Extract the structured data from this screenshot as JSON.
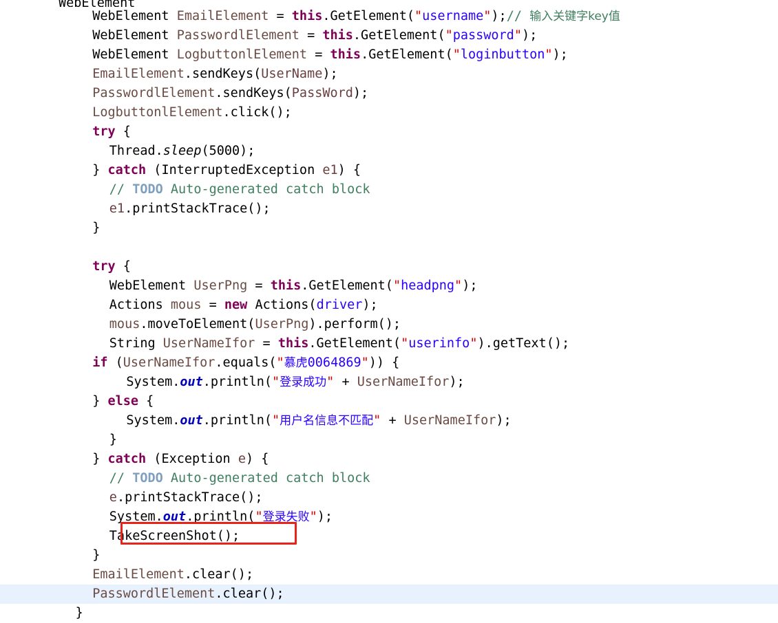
{
  "editor": {
    "name": "java-code-editor",
    "language": "Java",
    "background": "#ffffff",
    "current_line_highlight": "#e8f2fe",
    "annotation_color": "#e8231a",
    "colors": {
      "keyword": "#7f0055",
      "string": "#2a00ff",
      "quote": "#d40000",
      "comment": "#3f7f5f",
      "todo": "#7f9fbf",
      "field": "#6a4b43",
      "static_field": "#0000c0",
      "plain": "#000000"
    }
  },
  "annotation": {
    "label": "red-rectangle-around-takescreenshot-call",
    "target_text": "TakeScreenShot();"
  },
  "code": {
    "lines": [
      {
        "id": "line-partial-top",
        "indent": 0,
        "clipped": true,
        "tokens": [
          {
            "t": "WebElement ",
            "c": "plain"
          }
        ]
      },
      {
        "id": "line-1",
        "indent": 2,
        "tokens": [
          {
            "t": "WebElement ",
            "c": "plain"
          },
          {
            "t": "EmailElement",
            "c": "field"
          },
          {
            "t": " = ",
            "c": "plain"
          },
          {
            "t": "this",
            "c": "kw"
          },
          {
            "t": ".GetElement(",
            "c": "plain"
          },
          {
            "t": "\"",
            "c": "quote"
          },
          {
            "t": "username",
            "c": "str"
          },
          {
            "t": "\"",
            "c": "quote"
          },
          {
            "t": ");",
            "c": "plain"
          },
          {
            "t": "// ",
            "c": "cmt"
          },
          {
            "t": "输入关键字key值",
            "c": "cmt cjk"
          }
        ]
      },
      {
        "id": "line-2",
        "indent": 2,
        "tokens": [
          {
            "t": "WebElement ",
            "c": "plain"
          },
          {
            "t": "PasswordlElement",
            "c": "field"
          },
          {
            "t": " = ",
            "c": "plain"
          },
          {
            "t": "this",
            "c": "kw"
          },
          {
            "t": ".GetElement(",
            "c": "plain"
          },
          {
            "t": "\"",
            "c": "quote"
          },
          {
            "t": "password",
            "c": "str"
          },
          {
            "t": "\"",
            "c": "quote"
          },
          {
            "t": ");",
            "c": "plain"
          }
        ]
      },
      {
        "id": "line-3",
        "indent": 2,
        "tokens": [
          {
            "t": "WebElement ",
            "c": "plain"
          },
          {
            "t": "LogbuttonlElement",
            "c": "field"
          },
          {
            "t": " = ",
            "c": "plain"
          },
          {
            "t": "this",
            "c": "kw"
          },
          {
            "t": ".GetElement(",
            "c": "plain"
          },
          {
            "t": "\"",
            "c": "quote"
          },
          {
            "t": "loginbutton",
            "c": "str"
          },
          {
            "t": "\"",
            "c": "quote"
          },
          {
            "t": ");",
            "c": "plain"
          }
        ]
      },
      {
        "id": "line-4",
        "indent": 2,
        "tokens": [
          {
            "t": "EmailElement",
            "c": "field"
          },
          {
            "t": ".sendKeys(",
            "c": "plain"
          },
          {
            "t": "UserName",
            "c": "param"
          },
          {
            "t": ");",
            "c": "plain"
          }
        ]
      },
      {
        "id": "line-5",
        "indent": 2,
        "tokens": [
          {
            "t": "PasswordlElement",
            "c": "field"
          },
          {
            "t": ".sendKeys(",
            "c": "plain"
          },
          {
            "t": "PassWord",
            "c": "param"
          },
          {
            "t": ");",
            "c": "plain"
          }
        ]
      },
      {
        "id": "line-6",
        "indent": 2,
        "tokens": [
          {
            "t": "LogbuttonlElement",
            "c": "field"
          },
          {
            "t": ".click();",
            "c": "plain"
          }
        ]
      },
      {
        "id": "line-7",
        "indent": 2,
        "tokens": [
          {
            "t": "try",
            "c": "kw"
          },
          {
            "t": " {",
            "c": "plain"
          }
        ]
      },
      {
        "id": "line-8",
        "indent": 3,
        "tokens": [
          {
            "t": "Thread.",
            "c": "plain"
          },
          {
            "t": "sleep",
            "c": "italic"
          },
          {
            "t": "(5000);",
            "c": "plain"
          }
        ]
      },
      {
        "id": "line-9",
        "indent": 2,
        "tokens": [
          {
            "t": "} ",
            "c": "plain"
          },
          {
            "t": "catch",
            "c": "kw"
          },
          {
            "t": " (InterruptedException ",
            "c": "plain"
          },
          {
            "t": "e1",
            "c": "param"
          },
          {
            "t": ") {",
            "c": "plain"
          }
        ]
      },
      {
        "id": "line-10",
        "indent": 3,
        "tokens": [
          {
            "t": "// ",
            "c": "cmt"
          },
          {
            "t": "TODO",
            "c": "todo"
          },
          {
            "t": " Auto-generated catch block",
            "c": "cmt"
          }
        ]
      },
      {
        "id": "line-11",
        "indent": 3,
        "tokens": [
          {
            "t": "e1",
            "c": "param"
          },
          {
            "t": ".printStackTrace();",
            "c": "plain"
          }
        ]
      },
      {
        "id": "line-12",
        "indent": 2,
        "tokens": [
          {
            "t": "}",
            "c": "plain"
          }
        ]
      },
      {
        "id": "line-13",
        "indent": 0,
        "tokens": []
      },
      {
        "id": "line-14",
        "indent": 2,
        "tokens": [
          {
            "t": "try",
            "c": "kw"
          },
          {
            "t": " {",
            "c": "plain"
          }
        ]
      },
      {
        "id": "line-15",
        "indent": 3,
        "tokens": [
          {
            "t": "WebElement ",
            "c": "plain"
          },
          {
            "t": "UserPng",
            "c": "localvar"
          },
          {
            "t": " = ",
            "c": "plain"
          },
          {
            "t": "this",
            "c": "kw"
          },
          {
            "t": ".GetElement(",
            "c": "plain"
          },
          {
            "t": "\"",
            "c": "quote"
          },
          {
            "t": "headpng",
            "c": "str"
          },
          {
            "t": "\"",
            "c": "quote"
          },
          {
            "t": ");",
            "c": "plain"
          }
        ]
      },
      {
        "id": "line-16",
        "indent": 3,
        "tokens": [
          {
            "t": "Actions ",
            "c": "plain"
          },
          {
            "t": "mous",
            "c": "localvar"
          },
          {
            "t": " = ",
            "c": "plain"
          },
          {
            "t": "new",
            "c": "kw"
          },
          {
            "t": " Actions(",
            "c": "plain"
          },
          {
            "t": "driver",
            "c": "blueid"
          },
          {
            "t": ");",
            "c": "plain"
          }
        ]
      },
      {
        "id": "line-17",
        "indent": 3,
        "tokens": [
          {
            "t": "mous",
            "c": "localvar"
          },
          {
            "t": ".moveToElement(",
            "c": "plain"
          },
          {
            "t": "UserPng",
            "c": "localvar"
          },
          {
            "t": ").perform();",
            "c": "plain"
          }
        ]
      },
      {
        "id": "line-18",
        "indent": 3,
        "tokens": [
          {
            "t": "String ",
            "c": "plain"
          },
          {
            "t": "UserNameIfor",
            "c": "localvar"
          },
          {
            "t": " = ",
            "c": "plain"
          },
          {
            "t": "this",
            "c": "kw"
          },
          {
            "t": ".GetElement(",
            "c": "plain"
          },
          {
            "t": "\"",
            "c": "quote"
          },
          {
            "t": "userinfo",
            "c": "str"
          },
          {
            "t": "\"",
            "c": "quote"
          },
          {
            "t": ").getText();",
            "c": "plain"
          }
        ]
      },
      {
        "id": "line-19",
        "indent": 2,
        "tokens": [
          {
            "t": "if",
            "c": "kw"
          },
          {
            "t": " (",
            "c": "plain"
          },
          {
            "t": "UserNameIfor",
            "c": "localvar"
          },
          {
            "t": ".equals(",
            "c": "plain"
          },
          {
            "t": "\"",
            "c": "quote"
          },
          {
            "t": "慕虎",
            "c": "str cjk"
          },
          {
            "t": "0064869",
            "c": "str"
          },
          {
            "t": "\"",
            "c": "quote"
          },
          {
            "t": ")) {",
            "c": "plain"
          }
        ]
      },
      {
        "id": "line-20",
        "indent": 4,
        "tokens": [
          {
            "t": "System.",
            "c": "plain"
          },
          {
            "t": "out",
            "c": "static"
          },
          {
            "t": ".println(",
            "c": "plain"
          },
          {
            "t": "\"",
            "c": "quote"
          },
          {
            "t": "登录成功",
            "c": "str cjk"
          },
          {
            "t": "\"",
            "c": "quote"
          },
          {
            "t": " + ",
            "c": "plain"
          },
          {
            "t": "UserNameIfor",
            "c": "localvar"
          },
          {
            "t": ");",
            "c": "plain"
          }
        ]
      },
      {
        "id": "line-21",
        "indent": 2,
        "tokens": [
          {
            "t": "} ",
            "c": "plain"
          },
          {
            "t": "else",
            "c": "kw"
          },
          {
            "t": " {",
            "c": "plain"
          }
        ]
      },
      {
        "id": "line-22",
        "indent": 4,
        "tokens": [
          {
            "t": "System.",
            "c": "plain"
          },
          {
            "t": "out",
            "c": "static"
          },
          {
            "t": ".println(",
            "c": "plain"
          },
          {
            "t": "\"",
            "c": "quote"
          },
          {
            "t": "用户名信息不匹配",
            "c": "str cjk"
          },
          {
            "t": "\"",
            "c": "quote"
          },
          {
            "t": " + ",
            "c": "plain"
          },
          {
            "t": "UserNameIfor",
            "c": "localvar"
          },
          {
            "t": ");",
            "c": "plain"
          }
        ]
      },
      {
        "id": "line-23",
        "indent": 3,
        "tokens": [
          {
            "t": "}",
            "c": "plain"
          }
        ]
      },
      {
        "id": "line-24",
        "indent": 2,
        "tokens": [
          {
            "t": "} ",
            "c": "plain"
          },
          {
            "t": "catch",
            "c": "kw"
          },
          {
            "t": " (Exception ",
            "c": "plain"
          },
          {
            "t": "e",
            "c": "param"
          },
          {
            "t": ") {",
            "c": "plain"
          }
        ]
      },
      {
        "id": "line-25",
        "indent": 3,
        "tokens": [
          {
            "t": "// ",
            "c": "cmt"
          },
          {
            "t": "TODO",
            "c": "todo"
          },
          {
            "t": " Auto-generated catch block",
            "c": "cmt"
          }
        ]
      },
      {
        "id": "line-26",
        "indent": 3,
        "tokens": [
          {
            "t": "e",
            "c": "param"
          },
          {
            "t": ".printStackTrace();",
            "c": "plain"
          }
        ]
      },
      {
        "id": "line-27",
        "indent": 3,
        "tokens": [
          {
            "t": "System.",
            "c": "plain"
          },
          {
            "t": "out",
            "c": "static"
          },
          {
            "t": ".println(",
            "c": "plain"
          },
          {
            "t": "\"",
            "c": "quote"
          },
          {
            "t": "登录失败",
            "c": "str cjk"
          },
          {
            "t": "\"",
            "c": "quote"
          },
          {
            "t": ");",
            "c": "plain"
          }
        ]
      },
      {
        "id": "line-28",
        "indent": 3,
        "boxed": true,
        "tokens": [
          {
            "t": "TakeScreenShot();",
            "c": "plain"
          }
        ]
      },
      {
        "id": "line-29",
        "indent": 2,
        "tokens": [
          {
            "t": "}",
            "c": "plain"
          }
        ]
      },
      {
        "id": "line-30",
        "indent": 2,
        "tokens": [
          {
            "t": "EmailElement",
            "c": "field"
          },
          {
            "t": ".clear();",
            "c": "plain"
          }
        ]
      },
      {
        "id": "line-31",
        "indent": 2,
        "current": true,
        "tokens": [
          {
            "t": "PasswordlElement",
            "c": "field"
          },
          {
            "t": ".clear();",
            "c": "plain"
          }
        ]
      },
      {
        "id": "line-32",
        "indent": 1,
        "tokens": [
          {
            "t": "}",
            "c": "plain"
          }
        ]
      }
    ]
  }
}
